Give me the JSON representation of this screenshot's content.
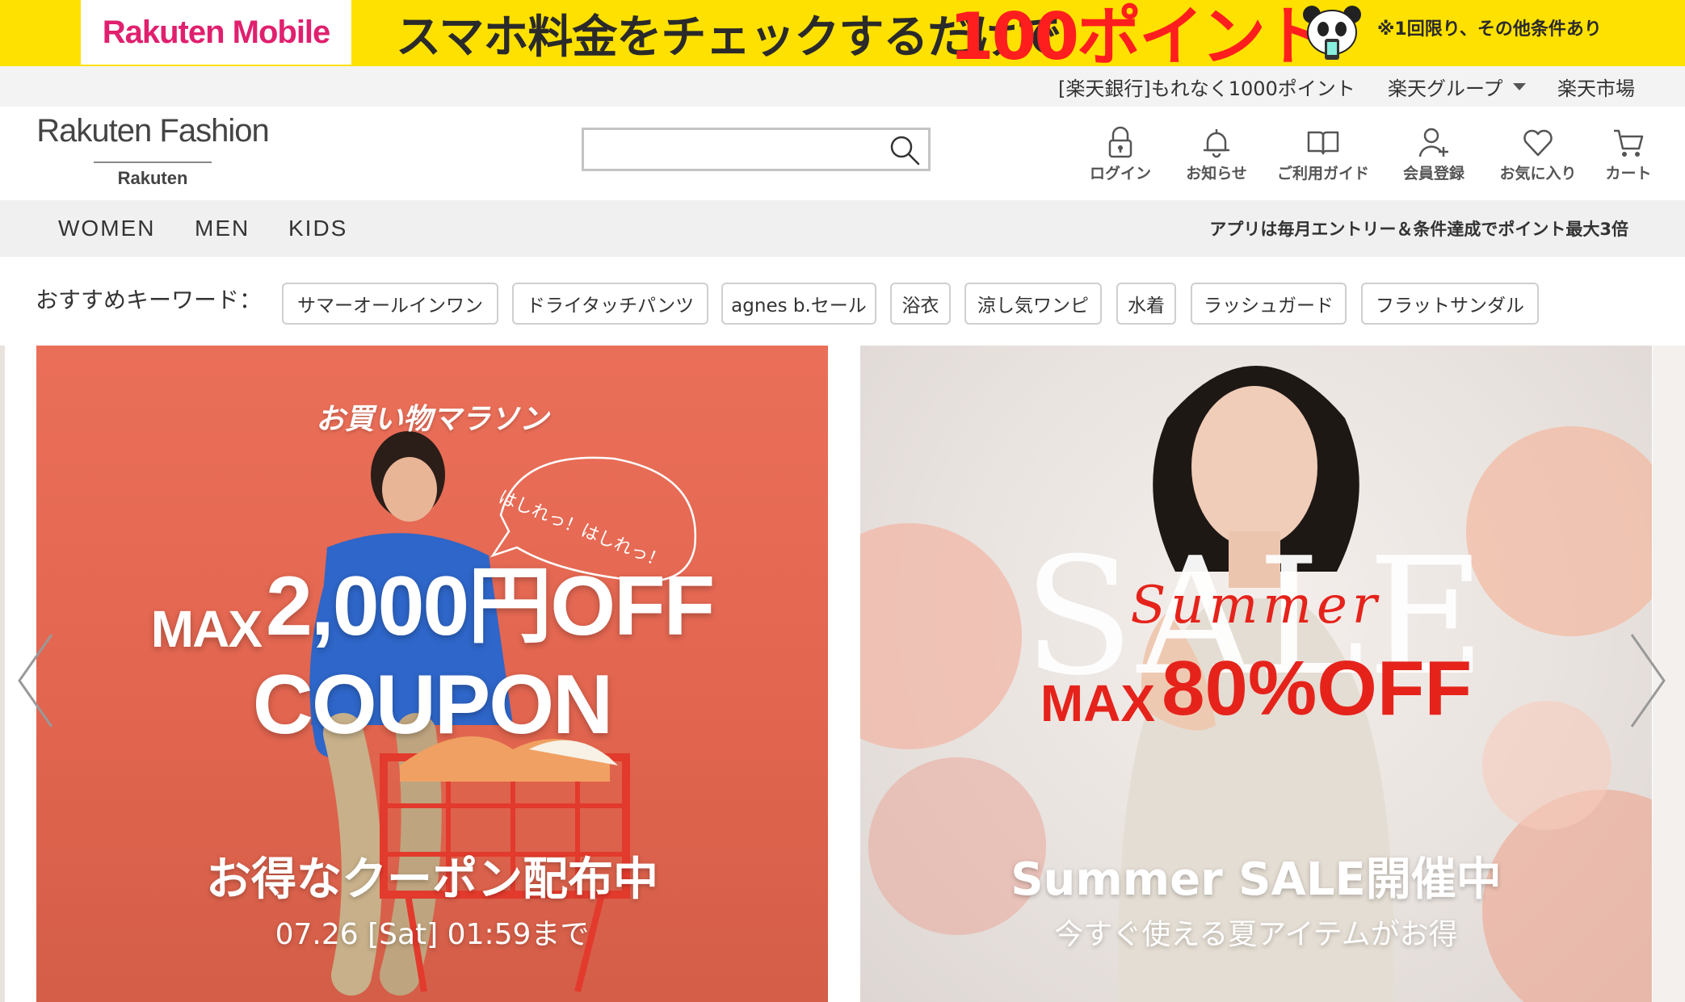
{
  "promo": {
    "logo": "Rakuten Mobile",
    "headline": "スマホ料金をチェックするだけで",
    "points": "100ポイント",
    "note": "※1回限り、その他条件あり",
    "colors": {
      "background": "#ffe100",
      "logo": "#e0206e",
      "points": "#ff1e1e"
    }
  },
  "utility": {
    "links": [
      {
        "label": "[楽天銀行]もれなく1000ポイント"
      },
      {
        "label": "楽天グループ"
      },
      {
        "label": "楽天市場"
      }
    ]
  },
  "header": {
    "brand": "Rakuten Fashion",
    "brand_sub": "Rakuten",
    "search": {
      "placeholder": "",
      "value": ""
    },
    "icons": [
      {
        "label": "ログイン",
        "icon": "lock-icon"
      },
      {
        "label": "お知らせ",
        "icon": "bell-icon"
      },
      {
        "label": "ご利用ガイド",
        "icon": "book-icon"
      },
      {
        "label": "会員登録",
        "icon": "user-add-icon"
      },
      {
        "label": "お気に入り",
        "icon": "heart-icon"
      },
      {
        "label": "カート",
        "icon": "cart-icon"
      }
    ]
  },
  "nav": {
    "categories": [
      "WOMEN",
      "MEN",
      "KIDS"
    ],
    "app_promo": "アプリは毎月エントリー＆条件達成でポイント最大3倍"
  },
  "keywords": {
    "label": "おすすめキーワード：",
    "items": [
      "サマーオールインワン",
      "ドライタッチパンツ",
      "agnes b.セール",
      "浴衣",
      "涼し気ワンピ",
      "水着",
      "ラッシュガード",
      "フラットサンダル"
    ]
  },
  "carousel": {
    "slides": [
      {
        "top_label": "お買い物マラソン",
        "speech": "はしれっ！はしれっ！",
        "max": "MAX",
        "amount": "2,000円OFF",
        "coupon": "COUPON",
        "caption": "お得なクーポン配布中",
        "sub": "07.26 [Sat] 01:59まで",
        "bg_color": "#e66a54"
      },
      {
        "big_word": "SALE",
        "script_word": "Summer",
        "max": "MAX",
        "amount": "80%OFF",
        "caption": "Summer SALE開催中",
        "sub": "今すぐ使える夏アイテムがお得",
        "accent_color": "#e5231b"
      }
    ]
  }
}
